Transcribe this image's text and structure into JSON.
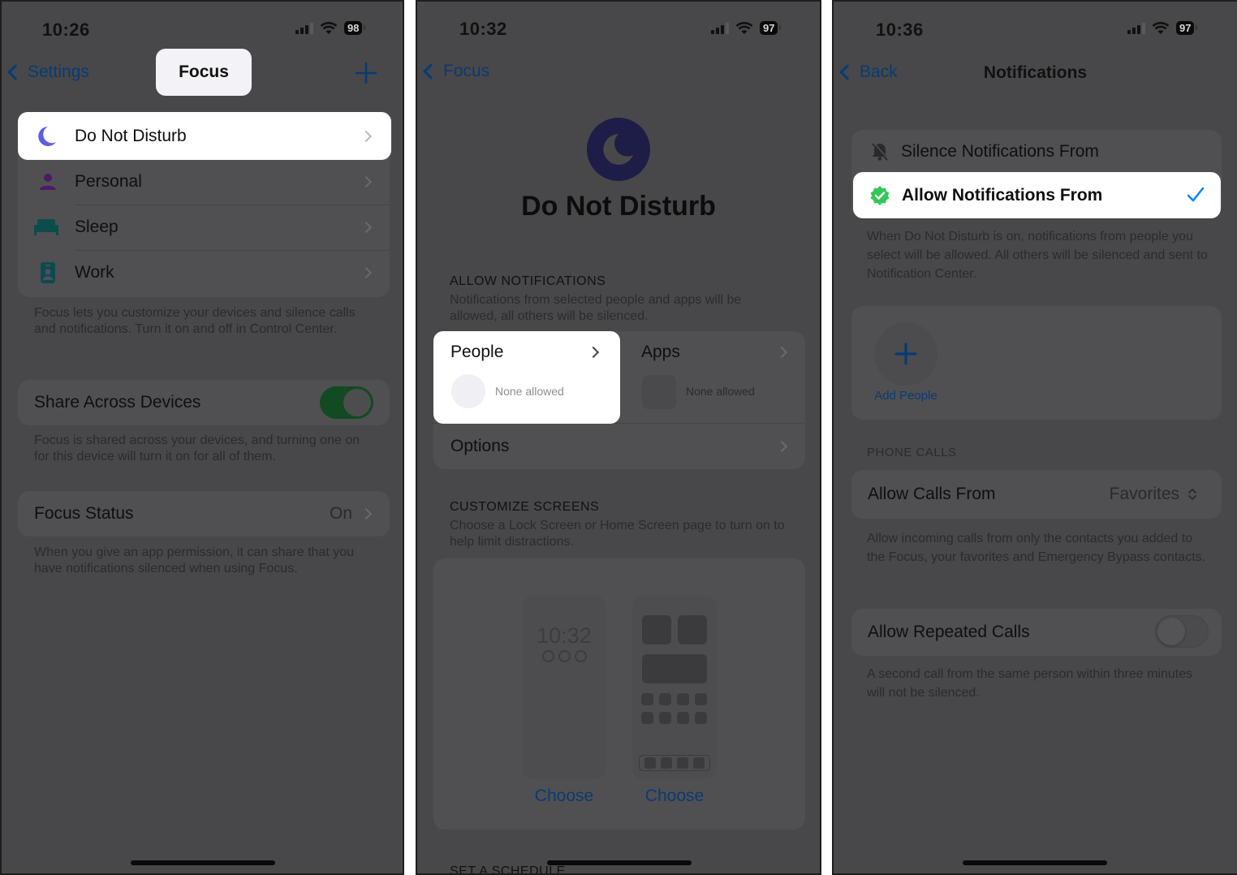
{
  "panels": [
    {
      "status": {
        "time": "10:26",
        "battery": "98"
      },
      "nav": {
        "back_label": "Settings",
        "title": "Focus",
        "add_icon": "plus-icon"
      },
      "focus_modes": [
        {
          "label": "Do Not Disturb",
          "icon": "moon-icon",
          "color": "#5e5ce6",
          "highlighted": true
        },
        {
          "label": "Personal",
          "icon": "person-icon",
          "color": "#4e1a66"
        },
        {
          "label": "Sleep",
          "icon": "bed-icon",
          "color": "#0b4d48"
        },
        {
          "label": "Work",
          "icon": "id-badge-icon",
          "color": "#0d4a4f"
        }
      ],
      "modes_footnote": "Focus lets you customize your devices and silence calls and notifications. Turn it on and off in Control Center.",
      "share": {
        "label": "Share Across Devices",
        "enabled": true,
        "footnote": "Focus is shared across your devices, and turning one on for this device will turn it on for all of them."
      },
      "focus_status": {
        "label": "Focus Status",
        "value": "On",
        "footnote": "When you give an app permission, it can share that you have notifications silenced when using Focus."
      }
    },
    {
      "status": {
        "time": "10:32",
        "battery": "97"
      },
      "nav": {
        "back_label": "Focus"
      },
      "hero": {
        "title": "Do Not Disturb",
        "icon": "moon-icon"
      },
      "allow": {
        "header": "ALLOW NOTIFICATIONS",
        "description": "Notifications from selected people and apps will be allowed, all others will be silenced.",
        "people": {
          "label": "People",
          "value": "None allowed"
        },
        "apps": {
          "label": "Apps",
          "value": "None allowed"
        },
        "options_label": "Options"
      },
      "customize": {
        "header": "CUSTOMIZE SCREENS",
        "description": "Choose a Lock Screen or Home Screen page to turn on to help limit distractions.",
        "lock_time": "10:32",
        "choose_lock": "Choose",
        "choose_home": "Choose"
      },
      "schedule_header": "SET A SCHEDULE"
    },
    {
      "status": {
        "time": "10:36",
        "battery": "97"
      },
      "nav": {
        "back_label": "Back",
        "title": "Notifications"
      },
      "mode_options": [
        {
          "label": "Silence Notifications From",
          "icon": "bell-slash-icon",
          "selected": false
        },
        {
          "label": "Allow Notifications From",
          "icon": "check-seal-icon",
          "selected": true
        }
      ],
      "mode_footnote": "When Do Not Disturb is on, notifications from people you select will be allowed. All others will be silenced and sent to Notification Center.",
      "add_people_label": "Add People",
      "phone_calls": {
        "header": "PHONE CALLS",
        "allow_calls_label": "Allow Calls From",
        "allow_calls_value": "Favorites",
        "allow_calls_footnote": "Allow incoming calls from only the contacts you added to the Focus, your favorites and Emergency Bypass contacts.",
        "repeated_label": "Allow Repeated Calls",
        "repeated_enabled": false,
        "repeated_footnote": "A second call from the same person within three minutes will not be silenced."
      }
    }
  ],
  "colors": {
    "dim_background": "#48484a",
    "card": "#505052",
    "link_blue_dimmed": "#0b3a73",
    "check_blue": "#0a84ff",
    "check_seal_green": "#34c759",
    "toggle_on_dimmed": "#124a22"
  }
}
